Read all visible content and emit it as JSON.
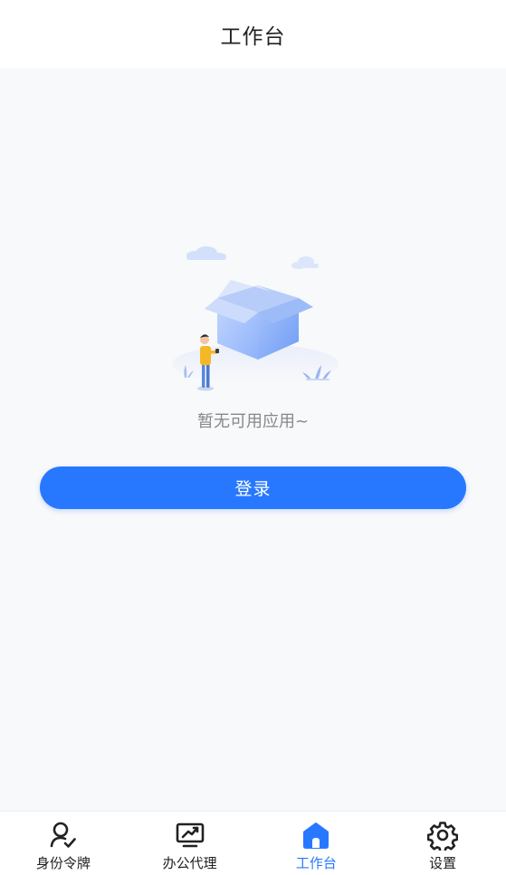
{
  "header": {
    "title": "工作台"
  },
  "main": {
    "empty_text": "暂无可用应用~",
    "login_label": "登录"
  },
  "tabbar": {
    "items": [
      {
        "label": "身份令牌",
        "icon": "user-check-icon",
        "active": false
      },
      {
        "label": "办公代理",
        "icon": "monitor-chart-icon",
        "active": false
      },
      {
        "label": "工作台",
        "icon": "home-icon",
        "active": true
      },
      {
        "label": "设置",
        "icon": "gear-icon",
        "active": false
      }
    ]
  },
  "colors": {
    "accent": "#2878ff",
    "text": "#222222",
    "muted": "#888888",
    "background": "#f8f9fa"
  }
}
